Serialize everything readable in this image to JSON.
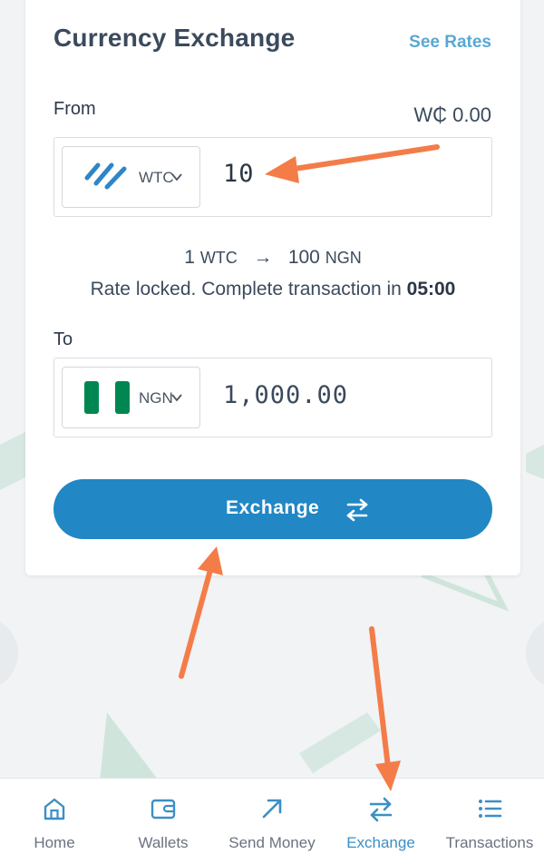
{
  "page": {
    "title": "Currency Exchange",
    "see_rates_label": "See Rates"
  },
  "from": {
    "label": "From",
    "balance": "W₵ 0.00",
    "currency_code": "WTC",
    "amount": "10"
  },
  "rate": {
    "from_amount": "1",
    "from_code": "WTC",
    "arrow": "→",
    "to_amount": "100",
    "to_code": "NGN",
    "lock_text": "Rate locked. Complete transaction in",
    "timer": "05:00"
  },
  "to": {
    "label": "To",
    "currency_code": "NGN",
    "amount": "1,000.00"
  },
  "exchange_button": {
    "label": "Exchange"
  },
  "tabs": [
    {
      "label": "Home",
      "icon": "home-icon"
    },
    {
      "label": "Wallets",
      "icon": "wallet-icon"
    },
    {
      "label": "Send Money",
      "icon": "send-arrow-icon"
    },
    {
      "label": "Exchange",
      "icon": "exchange-arrows-icon",
      "active": true
    },
    {
      "label": "Transactions",
      "icon": "list-icon"
    }
  ],
  "colors": {
    "primary": "#2187c5",
    "link": "#58a8d4",
    "active_tab": "#3c8fc4",
    "annotation_arrow": "#f47c48",
    "nigeria_green": "#008751",
    "deco_green": "#cde4db"
  }
}
